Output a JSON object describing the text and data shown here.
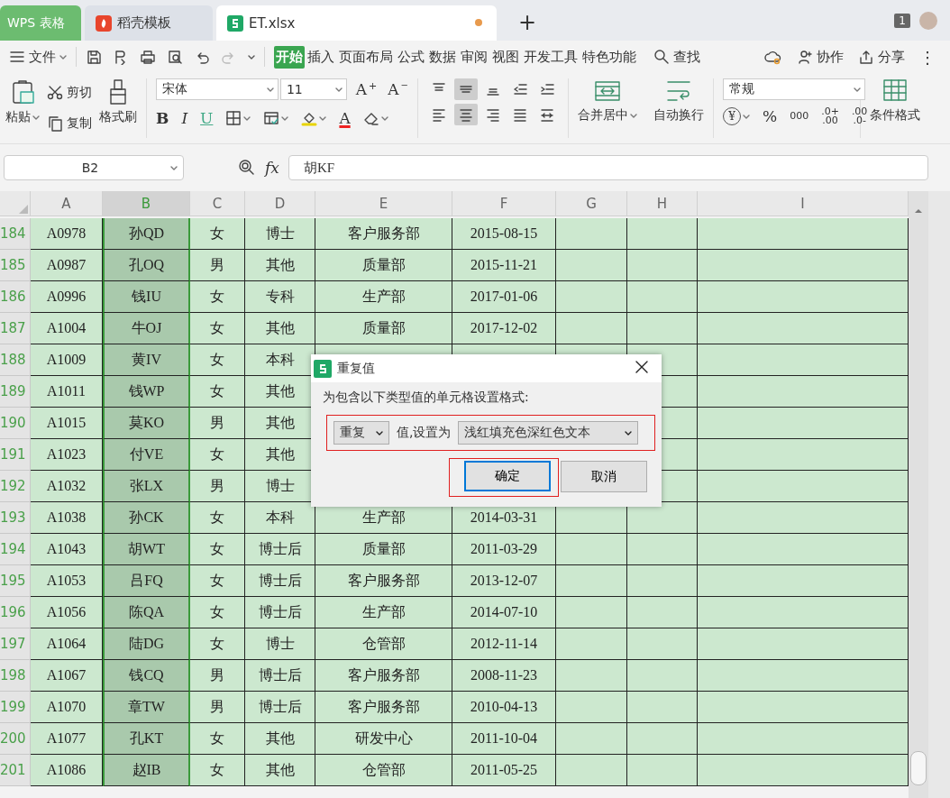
{
  "app_tabs": [
    {
      "label": "WPS 表格",
      "kind": "home",
      "selected": false
    },
    {
      "label": "稻壳模板",
      "kind": "docer",
      "selected": false
    },
    {
      "label": "ET.xlsx",
      "kind": "file",
      "selected": true,
      "unsaved": true
    }
  ],
  "new_tab": "+",
  "window_count": "1",
  "menu": {
    "file": "文件",
    "ribbon_tabs": [
      {
        "label": "开始",
        "selected": true
      },
      {
        "label": "插入",
        "selected": false
      },
      {
        "label": "页面布局",
        "selected": false
      },
      {
        "label": "公式",
        "selected": false
      },
      {
        "label": "数据",
        "selected": false
      },
      {
        "label": "审阅",
        "selected": false
      },
      {
        "label": "视图",
        "selected": false
      },
      {
        "label": "开发工具",
        "selected": false
      },
      {
        "label": "特色功能",
        "selected": false
      }
    ],
    "search": "查找",
    "collaborate": "协作",
    "share": "分享",
    "more": "⋮"
  },
  "ribbon": {
    "paste": "粘贴",
    "cut": "剪切",
    "copy": "复制",
    "format_painter": "格式刷",
    "font": "宋体",
    "font_size": "11",
    "font_buttons": [
      {
        "kind": "grow",
        "glyph": "A",
        "mark": "+"
      },
      {
        "kind": "shrink",
        "glyph": "A",
        "mark": "−"
      }
    ],
    "style_buttons": [
      {
        "kind": "bold",
        "glyph": "B"
      },
      {
        "kind": "italic",
        "glyph": "I"
      },
      {
        "kind": "underline",
        "glyph": "U"
      },
      {
        "kind": "border"
      },
      {
        "kind": "cell_style"
      },
      {
        "kind": "fill"
      },
      {
        "kind": "font_color",
        "glyph": "A"
      },
      {
        "kind": "clear"
      }
    ],
    "align_buttons": [
      {
        "kind": "top",
        "pressed": false
      },
      {
        "kind": "middle",
        "pressed": true
      },
      {
        "kind": "bottom",
        "pressed": false
      },
      {
        "kind": "outdent",
        "pressed": false
      },
      {
        "kind": "indent",
        "pressed": false
      },
      {
        "kind": "left",
        "pressed": false
      },
      {
        "kind": "center",
        "pressed": true
      },
      {
        "kind": "right",
        "pressed": false
      },
      {
        "kind": "justify",
        "pressed": false
      },
      {
        "kind": "distribute",
        "pressed": false
      }
    ],
    "merge": "合并居中",
    "wrap": "自动换行",
    "number_format": "常规",
    "number_buttons": [
      {
        "kind": "currency",
        "glyph": "¥"
      },
      {
        "kind": "percent",
        "glyph": "%"
      },
      {
        "kind": "thousands",
        "glyph": "000"
      },
      {
        "kind": "inc_decimal",
        "glyph": ".0+ .00"
      },
      {
        "kind": "dec_decimal",
        "glyph": ".00 .0-"
      }
    ],
    "conditional_format": "条件格式"
  },
  "formula_bar": {
    "name_box": "B2",
    "function_label": "fx",
    "value": "胡KF"
  },
  "grid": {
    "columns": [
      {
        "label": "A",
        "selected": false
      },
      {
        "label": "B",
        "selected": true
      },
      {
        "label": "C",
        "selected": false
      },
      {
        "label": "D",
        "selected": false
      },
      {
        "label": "E",
        "selected": false
      },
      {
        "label": "F",
        "selected": false
      },
      {
        "label": "G",
        "selected": false
      },
      {
        "label": "H",
        "selected": false
      },
      {
        "label": "I",
        "selected": false
      }
    ],
    "rows": [
      {
        "number": "184",
        "cells": [
          "A0978",
          "孙QD",
          "女",
          "博士",
          "客户服务部",
          "2015-08-15"
        ]
      },
      {
        "number": "185",
        "cells": [
          "A0987",
          "孔OQ",
          "男",
          "其他",
          "质量部",
          "2015-11-21"
        ]
      },
      {
        "number": "186",
        "cells": [
          "A0996",
          "钱IU",
          "女",
          "专科",
          "生产部",
          "2017-01-06"
        ]
      },
      {
        "number": "187",
        "cells": [
          "A1004",
          "牛OJ",
          "女",
          "其他",
          "质量部",
          "2017-12-02"
        ]
      },
      {
        "number": "188",
        "cells": [
          "A1009",
          "黄IV",
          "女",
          "本科"
        ]
      },
      {
        "number": "189",
        "cells": [
          "A1011",
          "钱WP",
          "女",
          "其他"
        ]
      },
      {
        "number": "190",
        "cells": [
          "A1015",
          "莫KO",
          "男",
          "其他"
        ]
      },
      {
        "number": "191",
        "cells": [
          "A1023",
          "付VE",
          "女",
          "其他"
        ]
      },
      {
        "number": "192",
        "cells": [
          "A1032",
          "张LX",
          "男",
          "博士"
        ]
      },
      {
        "number": "193",
        "cells": [
          "A1038",
          "孙CK",
          "女",
          "本科",
          "生产部",
          "2014-03-31"
        ]
      },
      {
        "number": "194",
        "cells": [
          "A1043",
          "胡WT",
          "女",
          "博士后",
          "质量部",
          "2011-03-29"
        ]
      },
      {
        "number": "195",
        "cells": [
          "A1053",
          "吕FQ",
          "女",
          "博士后",
          "客户服务部",
          "2013-12-07"
        ]
      },
      {
        "number": "196",
        "cells": [
          "A1056",
          "陈QA",
          "女",
          "博士后",
          "生产部",
          "2014-07-10"
        ]
      },
      {
        "number": "197",
        "cells": [
          "A1064",
          "陆DG",
          "女",
          "博士",
          "仓管部",
          "2012-11-14"
        ]
      },
      {
        "number": "198",
        "cells": [
          "A1067",
          "钱CQ",
          "男",
          "博士后",
          "客户服务部",
          "2008-11-23"
        ]
      },
      {
        "number": "199",
        "cells": [
          "A1070",
          "章TW",
          "男",
          "博士后",
          "客户服务部",
          "2010-04-13"
        ]
      },
      {
        "number": "200",
        "cells": [
          "A1077",
          "孔KT",
          "女",
          "其他",
          "研发中心",
          "2011-10-04"
        ]
      },
      {
        "number": "201",
        "cells": [
          "A1086",
          "赵IB",
          "女",
          "其他",
          "仓管部",
          "2011-05-25"
        ]
      }
    ]
  },
  "dialog": {
    "title": "重复值",
    "prompt": "为包含以下类型值的单元格设置格式:",
    "rule": "重复",
    "connector": "值,设置为",
    "style": "浅红填充色深红色文本",
    "ok": "确定",
    "cancel": "取消"
  }
}
